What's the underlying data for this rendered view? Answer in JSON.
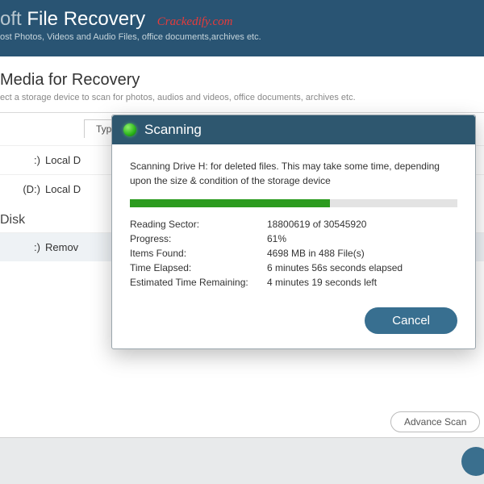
{
  "header": {
    "brand_suffix": "oft",
    "app_name": "File Recovery",
    "watermark": "Crackedify.com",
    "tagline": "ost Photos, Videos and Audio Files, office documents,archives etc."
  },
  "section": {
    "title": "Media for Recovery",
    "desc": "ect a storage device to scan for photos, audios and videos, office documents, archives etc."
  },
  "columns": {
    "type": "Type"
  },
  "drives": [
    {
      "label": ":)",
      "type": "Local D"
    },
    {
      "label": "(D:)",
      "type": "Local D"
    }
  ],
  "removable_section": "Disk",
  "removable": {
    "label": ":)",
    "type": "Remov"
  },
  "dialog": {
    "title": "Scanning",
    "message": "Scanning Drive H: for deleted files. This may take some time, depending upon the size & condition of the storage device",
    "progress_percent": 61,
    "stats": {
      "reading_sector_k": "Reading Sector:",
      "reading_sector_v": "18800619 of 30545920",
      "progress_k": "Progress:",
      "progress_v": "61%",
      "items_k": "Items Found:",
      "items_v": "4698 MB in 488 File(s)",
      "elapsed_k": "Time Elapsed:",
      "elapsed_v": "6 minutes 56s seconds elapsed",
      "remaining_k": "Estimated Time Remaining:",
      "remaining_v": "4 minutes 19 seconds left"
    },
    "cancel": "Cancel"
  },
  "advance_scan": "Advance Scan"
}
